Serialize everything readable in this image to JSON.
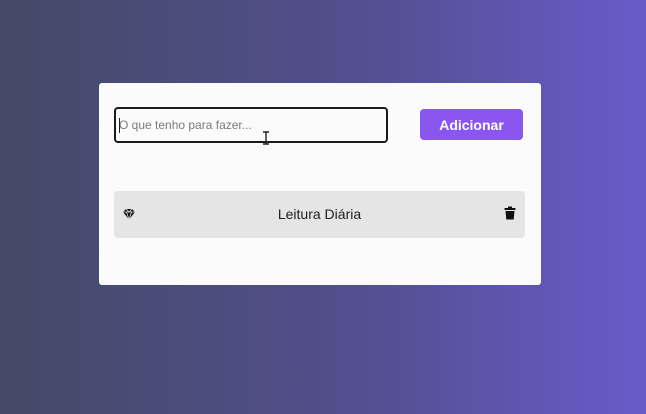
{
  "form": {
    "input_placeholder": "O que tenho para fazer...",
    "input_value": "",
    "add_button_label": "Adicionar"
  },
  "todos": [
    {
      "label": "Leitura Diária",
      "left_icon": "gem-icon",
      "right_icon": "trash-icon"
    }
  ],
  "colors": {
    "button": "#8a56ef",
    "card": "#fbfbfb",
    "item": "#e5e5e5",
    "gradient_start": "#434a66",
    "gradient_end": "#6a5ac9"
  }
}
